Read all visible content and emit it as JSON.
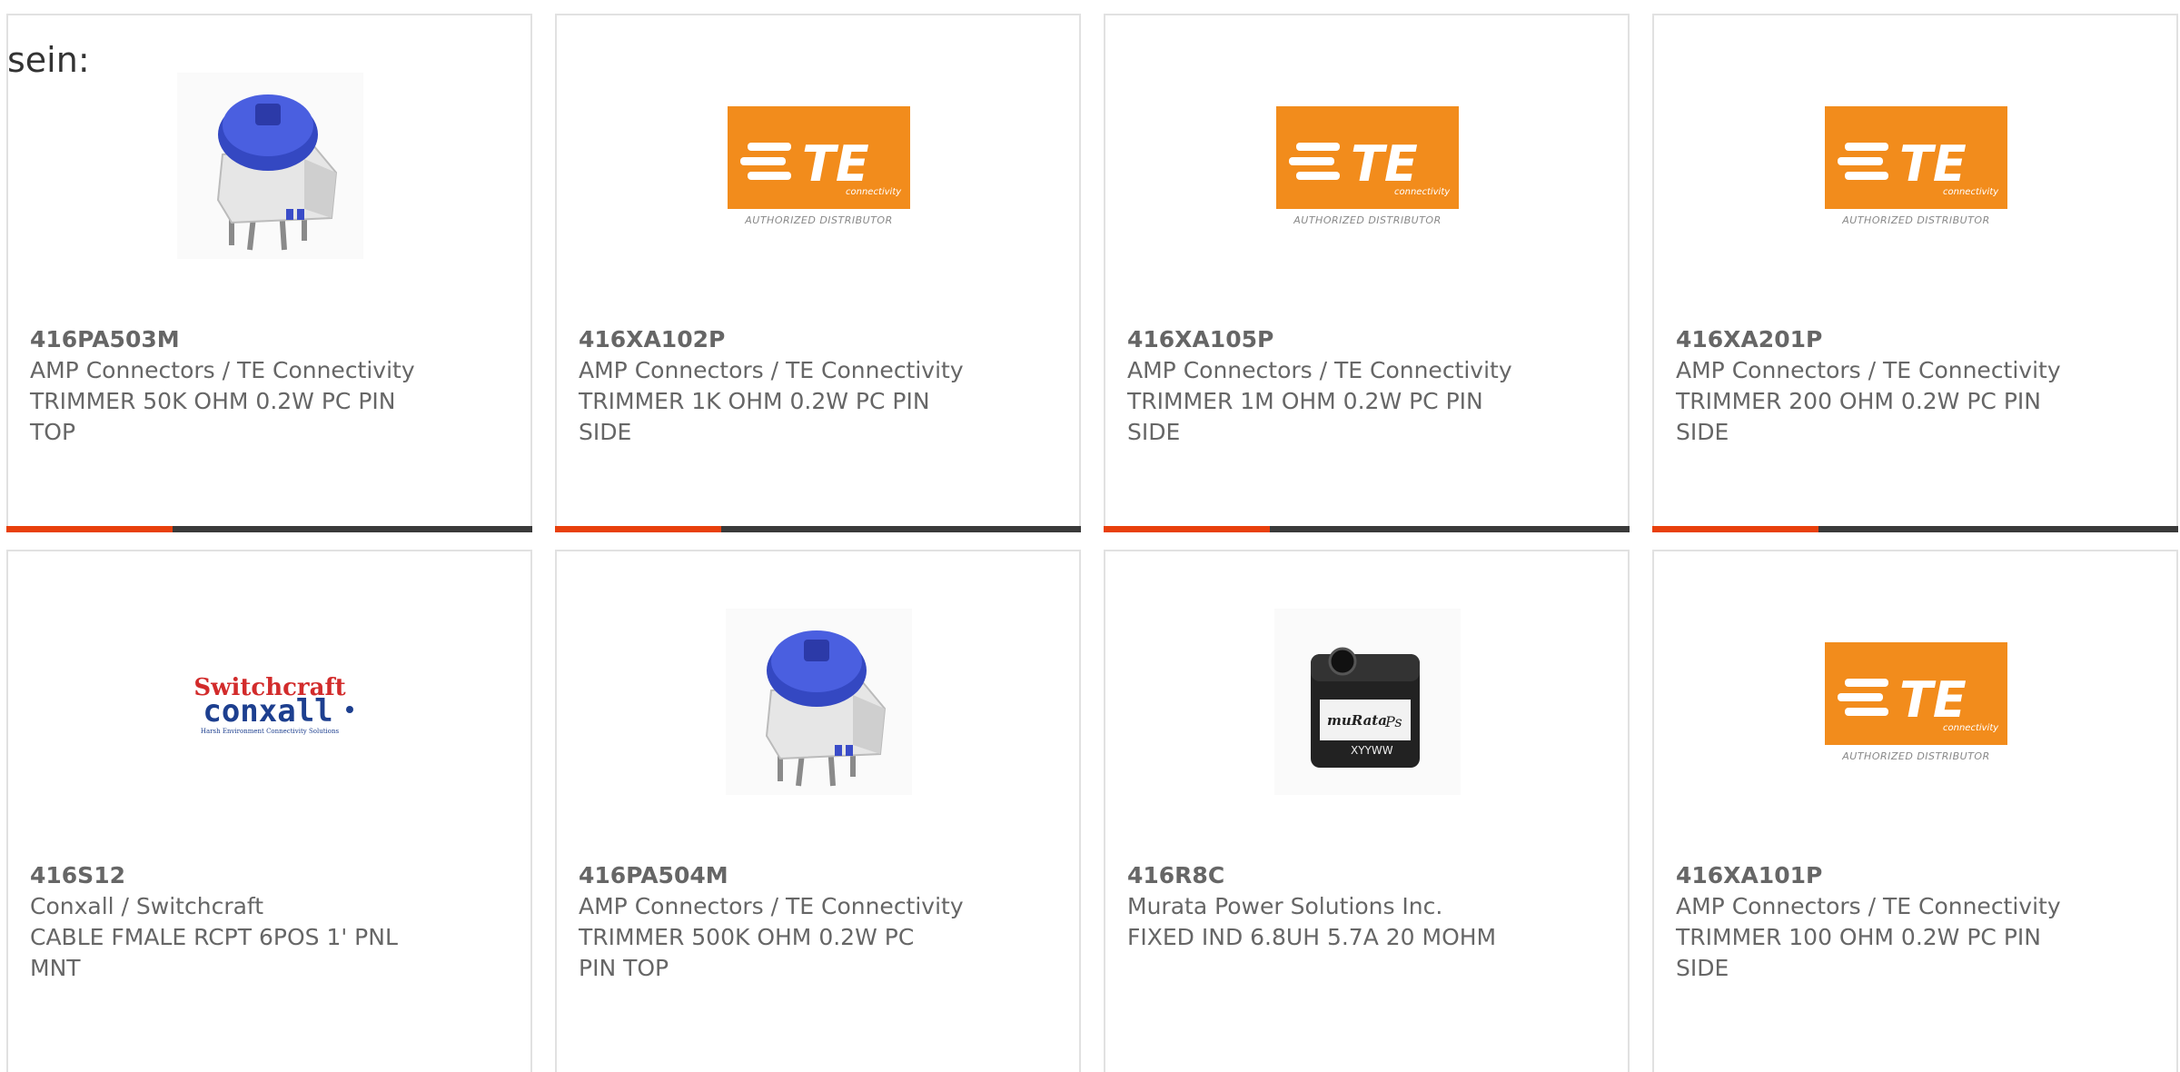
{
  "page_fragment": "sein:",
  "cards": [
    {
      "part": "416PA503M",
      "manufacturer": "AMP Connectors / TE Connectivity",
      "desc1": "TRIMMER 50K OHM 0.2W PC PIN",
      "desc2": "TOP",
      "image": "trimmer-image"
    },
    {
      "part": "416XA102P",
      "manufacturer": "AMP Connectors / TE Connectivity",
      "desc1": "TRIMMER 1K OHM 0.2W PC PIN",
      "desc2": "SIDE",
      "image": "te-logo"
    },
    {
      "part": "416XA105P",
      "manufacturer": "AMP Connectors / TE Connectivity",
      "desc1": "TRIMMER 1M OHM 0.2W PC PIN",
      "desc2": "SIDE",
      "image": "te-logo"
    },
    {
      "part": "416XA201P",
      "manufacturer": "AMP Connectors / TE Connectivity",
      "desc1": "TRIMMER 200 OHM 0.2W PC PIN",
      "desc2": "SIDE",
      "image": "te-logo"
    },
    {
      "part": "416S12",
      "manufacturer": "Conxall / Switchcraft",
      "desc1": "CABLE FMALE RCPT 6POS 1' PNL",
      "desc2": "MNT",
      "image": "switchcraft-logo"
    },
    {
      "part": "416PA504M",
      "manufacturer": "AMP Connectors / TE Connectivity",
      "desc1": "TRIMMER 500K OHM 0.2W PC",
      "desc2": "PIN TOP",
      "image": "trimmer-image"
    },
    {
      "part": "416R8C",
      "manufacturer": "Murata Power Solutions Inc.",
      "desc1": "FIXED IND 6.8UH 5.7A 20 MOHM",
      "desc2": "",
      "image": "inductor-image"
    },
    {
      "part": "416XA101P",
      "manufacturer": "AMP Connectors / TE Connectivity",
      "desc1": "TRIMMER 100 OHM 0.2W PC PIN",
      "desc2": "SIDE",
      "image": "te-logo"
    }
  ],
  "logos": {
    "te_text": "TE",
    "te_sub": "connectivity",
    "te_dist": "AUTHORIZED DISTRIBUTOR",
    "switchcraft": "Switchcraft",
    "conxall": "conxall",
    "conxall_tag": "Harsh Environment Connectivity Solutions",
    "murata_mark": "muRata",
    "murata_ps": "Ps",
    "murata_code": "XYYWW"
  },
  "colors": {
    "accent": "#e8400c",
    "te_orange": "#f28c1c",
    "text": "#666666",
    "border": "#e1e1e1"
  }
}
